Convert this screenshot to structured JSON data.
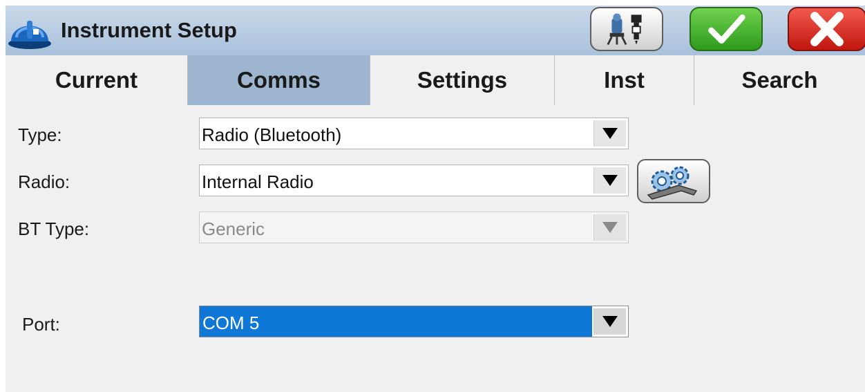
{
  "header": {
    "title": "Instrument Setup",
    "icons": {
      "app": "hard-hat-icon",
      "instrument": "instrument-connect-icon",
      "ok": "checkmark-icon",
      "cancel": "close-icon"
    }
  },
  "tabs": [
    {
      "label": "Current",
      "active": false
    },
    {
      "label": "Comms",
      "active": true
    },
    {
      "label": "Settings",
      "active": false
    },
    {
      "label": "Inst",
      "active": false
    },
    {
      "label": "Search",
      "active": false
    }
  ],
  "form": {
    "type": {
      "label": "Type:",
      "value": "Radio (Bluetooth)"
    },
    "radio": {
      "label": "Radio:",
      "value": "Internal Radio",
      "config_icon": "gears-wrench-icon"
    },
    "bt_type": {
      "label": "BT Type:",
      "value": "Generic",
      "disabled": true
    },
    "port": {
      "label": "Port:",
      "value": "COM 5",
      "selected": true
    }
  },
  "colors": {
    "title_bar": "#a9c1db",
    "active_tab": "#9db5cf",
    "selection": "#0f78d7",
    "ok_button": "#2e9a1c",
    "cancel_button": "#c0160e"
  }
}
